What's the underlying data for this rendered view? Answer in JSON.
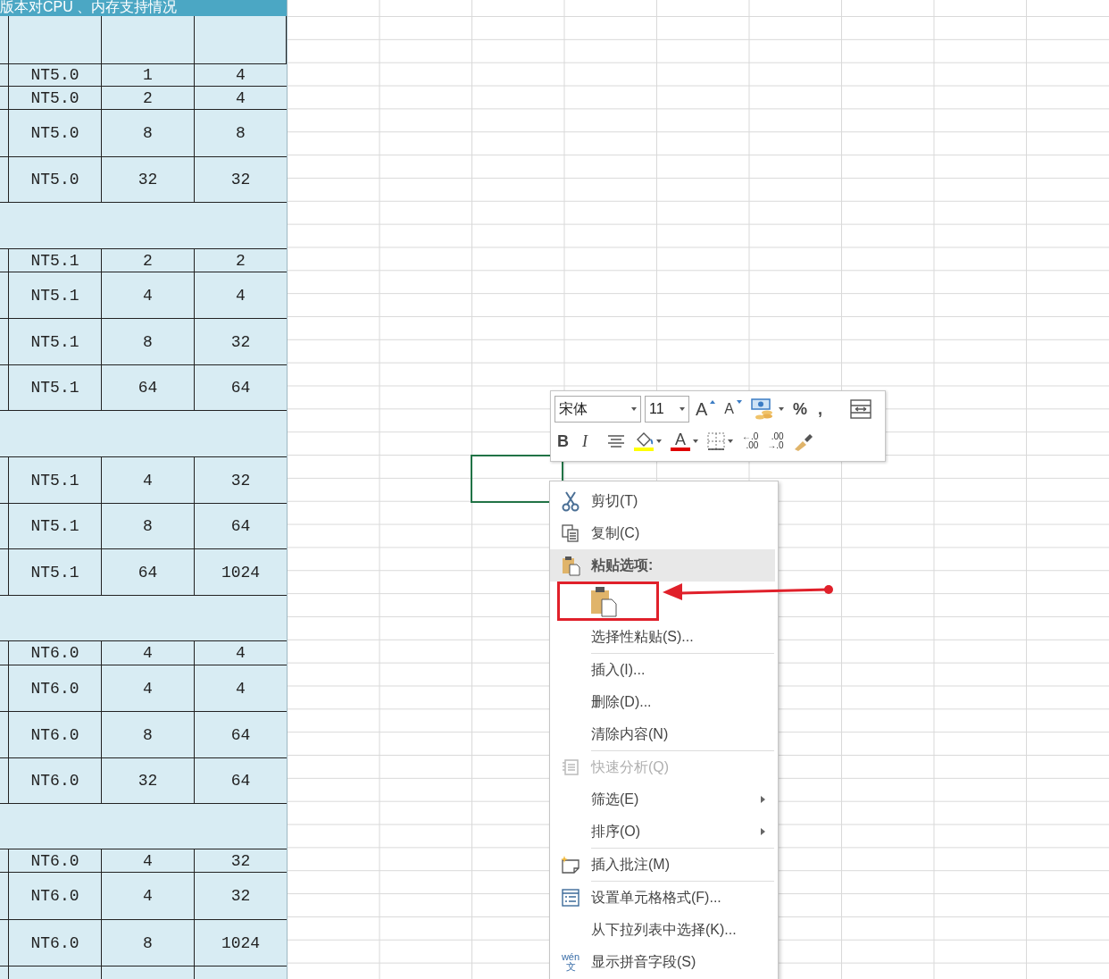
{
  "sheet": {
    "title": "版本对CPU 、内存支持情况",
    "rows": [
      {
        "kind": "data",
        "cells": [
          "NT5.0",
          "1",
          "4"
        ]
      },
      {
        "kind": "data",
        "cells": [
          "NT5.0",
          "2",
          "4"
        ]
      },
      {
        "kind": "data",
        "cells": [
          "NT5.0",
          "8",
          "8"
        ]
      },
      {
        "kind": "data",
        "cells": [
          "NT5.0",
          "32",
          "32"
        ]
      },
      {
        "kind": "gap"
      },
      {
        "kind": "data",
        "cells": [
          "NT5.1",
          "2",
          "2"
        ]
      },
      {
        "kind": "data",
        "cells": [
          "NT5.1",
          "4",
          "4"
        ]
      },
      {
        "kind": "data",
        "cells": [
          "NT5.1",
          "8",
          "32"
        ]
      },
      {
        "kind": "data",
        "cells": [
          "NT5.1",
          "64",
          "64"
        ]
      },
      {
        "kind": "gap"
      },
      {
        "kind": "data",
        "cells": [
          "NT5.1",
          "4",
          "32"
        ]
      },
      {
        "kind": "data",
        "cells": [
          "NT5.1",
          "8",
          "64"
        ]
      },
      {
        "kind": "data",
        "cells": [
          "NT5.1",
          "64",
          "1024"
        ]
      },
      {
        "kind": "gap"
      },
      {
        "kind": "data",
        "cells": [
          "NT6.0",
          "4",
          "4"
        ]
      },
      {
        "kind": "data",
        "cells": [
          "NT6.0",
          "4",
          "4"
        ]
      },
      {
        "kind": "data",
        "cells": [
          "NT6.0",
          "8",
          "64"
        ]
      },
      {
        "kind": "data",
        "cells": [
          "NT6.0",
          "32",
          "64"
        ]
      },
      {
        "kind": "gap"
      },
      {
        "kind": "data",
        "cells": [
          "NT6.0",
          "4",
          "32"
        ]
      },
      {
        "kind": "data",
        "cells": [
          "NT6.0",
          "4",
          "32"
        ]
      },
      {
        "kind": "data",
        "cells": [
          "NT6.0",
          "8",
          "1024"
        ]
      }
    ]
  },
  "mini_toolbar": {
    "font": "宋体",
    "size": "11",
    "grow_label": "A",
    "shrink_label": "A",
    "percent": "%",
    "comma": ",",
    "bold": "B",
    "italic": "I",
    "font_color_label": "A",
    "decimal_increase": [
      "←.0",
      ".00"
    ],
    "decimal_decrease": [
      ".00",
      "→.0"
    ]
  },
  "context_menu": {
    "items": [
      {
        "kind": "cut",
        "label": "剪切(T)",
        "disabled": false
      },
      {
        "kind": "copy",
        "label": "复制(C)",
        "disabled": false
      },
      {
        "kind": "paste-header",
        "label": "粘贴选项:",
        "disabled": false
      },
      {
        "kind": "paste-option",
        "disabled": false
      },
      {
        "kind": "plain",
        "label": "选择性粘贴(S)...",
        "disabled": false
      },
      {
        "kind": "plain",
        "label": "插入(I)...",
        "disabled": false
      },
      {
        "kind": "plain",
        "label": "删除(D)...",
        "disabled": false
      },
      {
        "kind": "plain",
        "label": "清除内容(N)",
        "disabled": false
      },
      {
        "kind": "quick-analysis",
        "label": "快速分析(Q)",
        "disabled": true
      },
      {
        "kind": "submenu",
        "label": "筛选(E)",
        "disabled": false
      },
      {
        "kind": "submenu",
        "label": "排序(O)",
        "disabled": false
      },
      {
        "kind": "comment",
        "label": "插入批注(M)",
        "disabled": false
      },
      {
        "kind": "format-cells",
        "label": "设置单元格格式(F)...",
        "disabled": false
      },
      {
        "kind": "plain",
        "label": "从下拉列表中选择(K)...",
        "disabled": false
      },
      {
        "kind": "pinyin",
        "label": "显示拼音字段(S)",
        "icon_text": [
          "wén",
          "文"
        ],
        "disabled": false
      }
    ]
  }
}
